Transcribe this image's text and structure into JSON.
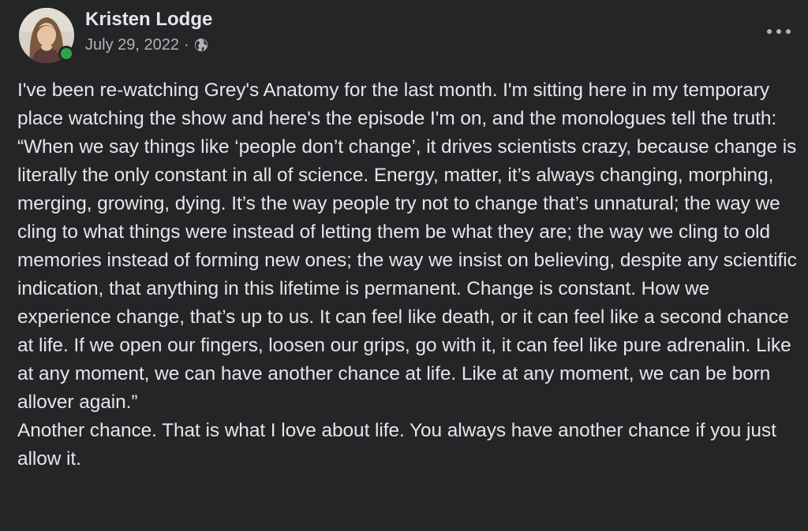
{
  "post": {
    "author": "Kristen Lodge",
    "date": "July 29, 2022",
    "separator": "·",
    "audience_icon": "globe-icon",
    "more_icon": "more-options-icon",
    "online_color": "#31a24c",
    "paragraphs": [
      "I've been re-watching Grey's Anatomy for the last month. I'm sitting here in my temporary place watching the show and here's the episode I'm on, and the monologues tell the truth:",
      "“When we say things like ‘people don’t change’, it drives scientists crazy, because change is literally the only constant in all of science. Energy, matter, it’s always changing, morphing, merging, growing, dying. It’s the way people try not to change that’s unnatural; the way we cling to what things were instead of letting them be what they are; the way we cling to old memories instead of forming new ones; the way we insist on believing, despite any scientific indication, that anything in this lifetime is permanent. Change is constant. How we experience change, that’s up to us. It can feel like death, or it can feel like a second chance at life. If we open our fingers, loosen our grips, go with it, it can feel like pure adrenalin. Like at any moment, we can have another chance at life. Like at any moment, we can be born allover again.”",
      "Another chance. That is what I love about life. You always have another chance if you just allow it."
    ]
  }
}
